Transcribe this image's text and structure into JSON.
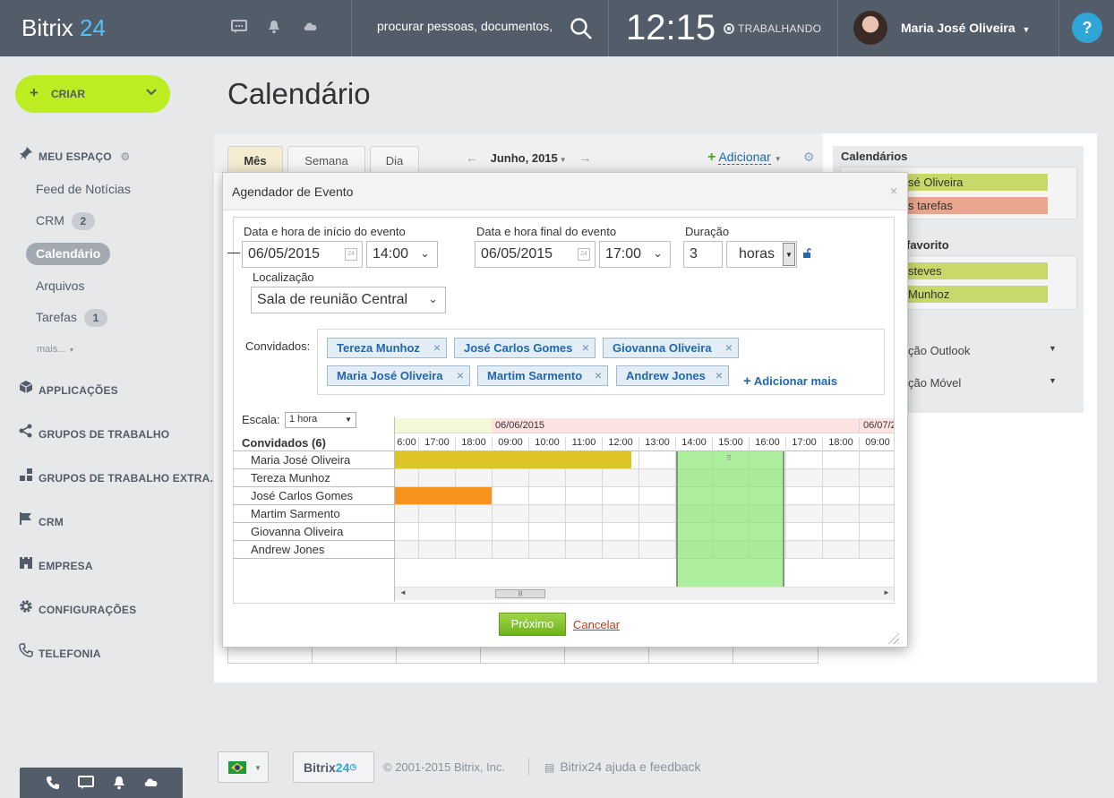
{
  "header": {
    "logo_text": "Bitrix",
    "logo_num": "24",
    "search_placeholder": "procurar pessoas, documentos,",
    "time": "12:15",
    "work_status": "TRABALHANDO",
    "user_name": "Maria José Oliveira",
    "help_label": "?"
  },
  "sidebar": {
    "create_label": "CRIAR",
    "my_space": "MEU ESPAÇO",
    "items": [
      {
        "label": "Feed de Notícias",
        "count": ""
      },
      {
        "label": "CRM",
        "count": "2"
      },
      {
        "label": "Calendário",
        "count": ""
      },
      {
        "label": "Arquivos",
        "count": ""
      },
      {
        "label": "Tarefas",
        "count": "1"
      }
    ],
    "more_label": "mais...",
    "sections": [
      "APPLICAÇÕES",
      "GRUPOS DE TRABALHO",
      "GRUPOS DE TRABALHO EXTRA...",
      "CRM",
      "EMPRESA",
      "CONFIGURAÇÕES",
      "TELEFONIA"
    ]
  },
  "page": {
    "title": "Calendário",
    "tabs": [
      "Mês",
      "Semana",
      "Dia"
    ],
    "month": "Junho, 2015",
    "add_label": "Adicionar"
  },
  "right_panel": {
    "calendars_title": "Calendários",
    "calendars": [
      "sé Oliveira",
      "s tarefas"
    ],
    "favorites_title": "favorito",
    "favorites": [
      "steves",
      "Munhoz"
    ],
    "options": [
      "ção Outlook",
      "ção Móvel"
    ]
  },
  "dialog": {
    "title": "Agendador de Evento",
    "start_label": "Data e hora de início do evento",
    "start_date": "06/05/2015",
    "start_time": "14:00",
    "end_label": "Data e hora final do evento",
    "end_date": "06/05/2015",
    "end_time": "17:00",
    "duration_label": "Duração",
    "duration_value": "3",
    "duration_unit": "horas",
    "location_label": "Localização",
    "location_value": "Sala de reunião Central",
    "invitees_label": "Convidados:",
    "invitees": [
      "Tereza Munhoz",
      "José Carlos Gomes",
      "Giovanna Oliveira",
      "Maria José Oliveira",
      "Martim Sarmento",
      "Andrew Jones"
    ],
    "add_more": "Adicionar mais",
    "scale_label": "Escala:",
    "scale_value": "1 hora",
    "guests_header": "Convidados (6)",
    "schedule_rows": [
      "Maria José Oliveira",
      "Tereza Munhoz",
      "José Carlos Gomes",
      "Martim Sarmento",
      "Giovanna Oliveira",
      "Andrew Jones"
    ],
    "date_headers": [
      "06/06/2015",
      "06/07/2"
    ],
    "hours": [
      "6:00",
      "17:00",
      "18:00",
      "09:00",
      "10:00",
      "11:00",
      "12:00",
      "13:00",
      "14:00",
      "15:00",
      "16:00",
      "17:00",
      "18:00",
      "09:00"
    ],
    "next_label": "Próximo",
    "cancel_label": "Cancelar"
  },
  "footer": {
    "logo_a": "Bitrix",
    "logo_b": "24",
    "copyright": "© 2001-2015 Bitrix, Inc.",
    "help": "Bitrix24 ajuda e feedback"
  },
  "colors": {
    "header_bg": "#535c69",
    "accent_green": "#bbed21",
    "busy_yellow": "#ddc427",
    "busy_orange": "#f7941d",
    "selection_green": "#a9ef9a"
  }
}
